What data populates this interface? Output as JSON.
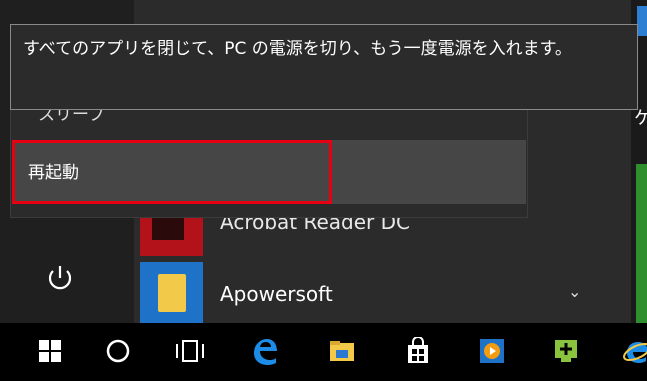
{
  "tooltip": {
    "text": "すべてのアプリを閉じて、PC の電源を切り、もう一度電源を入れます。"
  },
  "power_menu": {
    "sleep_label": "スリープ",
    "restart_label": "再起動"
  },
  "apps": {
    "acrobat_label": "Acrobat Reader DC",
    "apowersoft_label": "Apowersoft"
  },
  "tiles": {
    "partial_char": "ケ"
  },
  "colors": {
    "highlight_border": "#e60012",
    "accent_blue": "#1e73c8",
    "edge_blue": "#0078d7"
  },
  "taskbar": {
    "icons": [
      "windows-start-icon",
      "cortana-icon",
      "task-view-icon",
      "edge-icon",
      "file-explorer-icon",
      "store-icon",
      "media-player-icon",
      "green-app-icon",
      "ie-icon"
    ]
  }
}
